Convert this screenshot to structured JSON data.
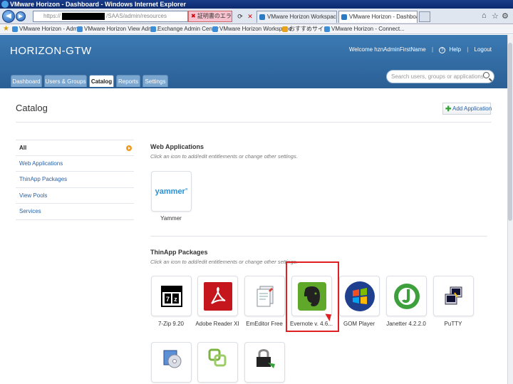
{
  "window": {
    "title": "VMware Horizon - Dashboard - Windows Internet Explorer"
  },
  "browser": {
    "url_prefix": "https://",
    "url_suffix": "/SAAS/admin/resources",
    "cert_error": "証明書のエラー",
    "tabs": [
      {
        "label": "VMware Horizon Workspace -..."
      },
      {
        "label": "VMware Horizon - Dashboa..."
      }
    ],
    "favorites": [
      "VMware Horizon - Admin",
      "VMware Horizon View Adm...",
      "Exchange Admin Center",
      "VMware Horizon Workspace",
      "おすすめサイト",
      "VMware Horizon - Connect..."
    ]
  },
  "app": {
    "brand": "HORIZON-GTW",
    "welcome": "Welcome hznAdminFirstName",
    "help": "Help",
    "logout": "Logout",
    "search_placeholder": "Search users, groups or applications",
    "tabs": [
      "Dashboard",
      "Users & Groups",
      "Catalog",
      "Reports",
      "Settings"
    ],
    "active_tab": "Catalog"
  },
  "page": {
    "title": "Catalog",
    "add_application": "Add Application",
    "sidebar": [
      "All",
      "Web Applications",
      "ThinApp Packages",
      "View Pools",
      "Services"
    ],
    "web_apps": {
      "heading": "Web Applications",
      "subtitle": "Click an icon to add/edit entitlements or change other settings.",
      "items": [
        {
          "label": "Yammer",
          "icon": "yammer-logo"
        }
      ]
    },
    "thinapp": {
      "heading": "ThinApp Packages",
      "subtitle": "Click an icon to add/edit entitlements or change other settings.",
      "items": [
        {
          "label": "7-Zip 9.20",
          "icon": "7zip-icon"
        },
        {
          "label": "Adobe Reader XI",
          "icon": "adobe-reader-icon"
        },
        {
          "label": "EmEditor Free",
          "icon": "emeditor-icon"
        },
        {
          "label": "Evernote v. 4.6...",
          "icon": "evernote-icon"
        },
        {
          "label": "GOM Player",
          "icon": "gom-player-icon"
        },
        {
          "label": "Janetter 4.2.2.0",
          "icon": "janetter-icon"
        },
        {
          "label": "PuTTY",
          "icon": "putty-icon"
        }
      ]
    },
    "yammer_logo_text": "yammer"
  },
  "colors": {
    "header": "#2f6aa3",
    "accent": "#f39a1d",
    "highlight": "#e02020"
  }
}
